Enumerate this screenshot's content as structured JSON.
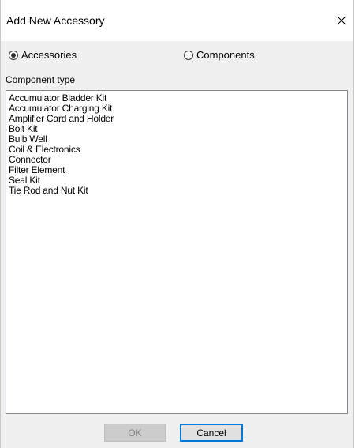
{
  "window": {
    "title": "Add New Accessory",
    "close_icon": "close-icon"
  },
  "options": {
    "accessories_label": "Accessories",
    "accessories_selected": true,
    "components_label": "Components",
    "components_selected": false
  },
  "component_type_label": "Component type",
  "component_types": [
    "Accumulator Bladder Kit",
    "Accumulator Charging Kit",
    "Amplifier Card and Holder",
    "Bolt Kit",
    "Bulb Well",
    "Coil & Electronics",
    "Connector",
    "Filter Element",
    "Seal Kit",
    "Tie Rod and Nut Kit"
  ],
  "buttons": {
    "ok_label": "OK",
    "ok_enabled": false,
    "cancel_label": "Cancel"
  },
  "colors": {
    "dialog_bg": "#f0f0f0",
    "focus_border": "#0078d7",
    "disabled_text": "#838383"
  }
}
